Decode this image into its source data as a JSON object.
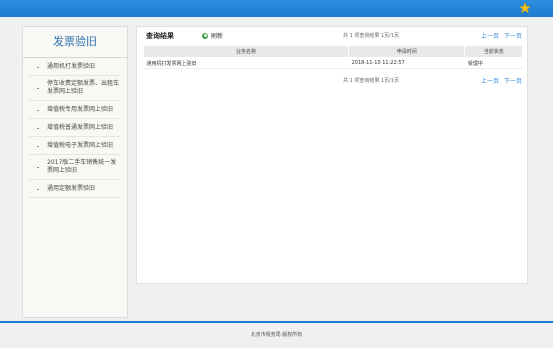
{
  "colors": {
    "brand": "#1d7ad0",
    "accent": "#2f86d8",
    "star": "#f0c020"
  },
  "header": {
    "star_icon": "star-icon"
  },
  "sidebar": {
    "title": "发票验旧",
    "items": [
      {
        "label": "通用机打发票验旧"
      },
      {
        "label": "停车收费定额发票、出租车发票网上验旧"
      },
      {
        "label": "增值税专用发票网上验旧"
      },
      {
        "label": "增值税普通发票网上验旧"
      },
      {
        "label": "增值税电子发票网上验旧"
      },
      {
        "label": "2017版二手车销售统一发票网上验旧"
      },
      {
        "label": "通用定额发票验旧"
      }
    ]
  },
  "main": {
    "title": "查询结果",
    "refresh_label": "刷新",
    "summary_top": "共 1 项查询结果 1页/1页",
    "summary_bottom": "共 1 项查询结果 1页/1页",
    "pager": {
      "prev": "上一页",
      "next": "下一页"
    },
    "table": {
      "columns": [
        "业务名称",
        "申请时间",
        "当前状态"
      ],
      "rows": [
        [
          "通用机打发票网上验旧",
          "2018-11-10 11:22:57",
          "受理中"
        ]
      ]
    }
  },
  "footer": {
    "text": "北京市税务局 版权所有"
  }
}
